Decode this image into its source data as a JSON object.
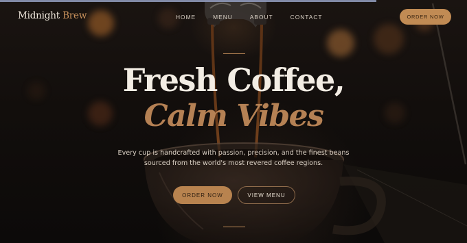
{
  "brand": {
    "name_primary": "Midnight",
    "name_accent": "Brew"
  },
  "nav": {
    "items": [
      {
        "label": "HOME"
      },
      {
        "label": "MENU"
      },
      {
        "label": "ABOUT"
      },
      {
        "label": "CONTACT"
      }
    ],
    "order_button": "ORDER NOW"
  },
  "hero": {
    "title": "Fresh Coffee,",
    "subtitle": "Calm Vibes",
    "description_line1": "Every cup is handcrafted with passion, precision, and the finest beans",
    "description_line2": "sourced from the world's most revered coffee regions.",
    "primary_button": "ORDER NOW",
    "secondary_button": "VIEW MENU"
  },
  "colors": {
    "accent": "#c18b54",
    "background": "#120e0c",
    "text": "#f3ede4",
    "subtitle": "#b58154"
  }
}
